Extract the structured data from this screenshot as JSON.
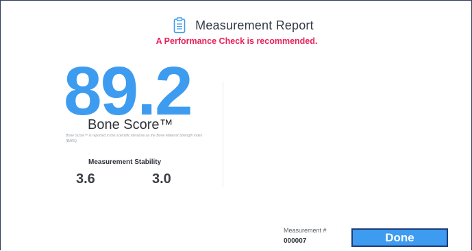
{
  "header": {
    "icon": "clipboard-icon",
    "title": "Measurement Report",
    "warning": "A Performance Check is recommended."
  },
  "score": {
    "value": "89.2",
    "label": "Bone Score™",
    "note": "Bone Score™ is reported in the scientific literature as the Bone Material Strength index (BMSi)"
  },
  "stability": {
    "title": "Measurement Stability",
    "values": [
      "3.6",
      "3.0"
    ]
  },
  "measurement": {
    "label": "Measurement #",
    "number": "000007"
  },
  "actions": {
    "done_label": "Done"
  },
  "colors": {
    "accent": "#3d9bf0",
    "warning": "#e8215a",
    "button_border": "#1f3b78",
    "frame_border": "#2e3a5a"
  }
}
